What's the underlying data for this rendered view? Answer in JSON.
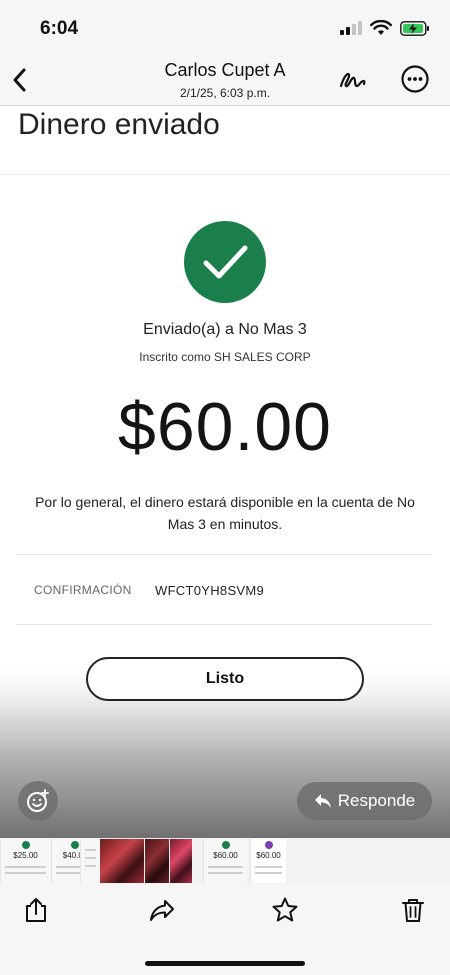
{
  "status": {
    "time": "6:04"
  },
  "header": {
    "title": "Carlos Cupet A",
    "subtitle": "2/1/25, 6:03 p.m.",
    "back_icon": "chevron-left-icon",
    "markup_icon": "signature-icon",
    "more_icon": "ellipsis-circle-icon"
  },
  "receipt": {
    "heading": "Dinero enviado",
    "sent_to": "Enviado(a) a No Mas 3",
    "enrolled_as": "Inscrito como SH SALES CORP",
    "amount": "$60.00",
    "note": "Por lo general, el dinero estará disponible en la cuenta de No Mas 3 en minutos.",
    "confirmation_label": "CONFIRMACIÓN",
    "confirmation_value": "WFCT0YH8SVM9",
    "done_label": "Listo",
    "accent_color": "#1a7f4b"
  },
  "overlay": {
    "reply_label": "Responde"
  },
  "thumbnails": [
    {
      "type": "receipt",
      "amount": "$25.00"
    },
    {
      "type": "receipt",
      "amount": "$40.00"
    },
    {
      "type": "receipt",
      "amount": ""
    },
    {
      "type": "photo",
      "amount": ""
    },
    {
      "type": "photo",
      "amount": ""
    },
    {
      "type": "photo",
      "amount": ""
    },
    {
      "type": "receipt",
      "amount": "$60.00"
    },
    {
      "type": "receipt",
      "amount": "$60.00"
    }
  ],
  "toolbar": {
    "icons": [
      "share-icon",
      "forward-icon",
      "star-icon",
      "trash-icon"
    ]
  }
}
